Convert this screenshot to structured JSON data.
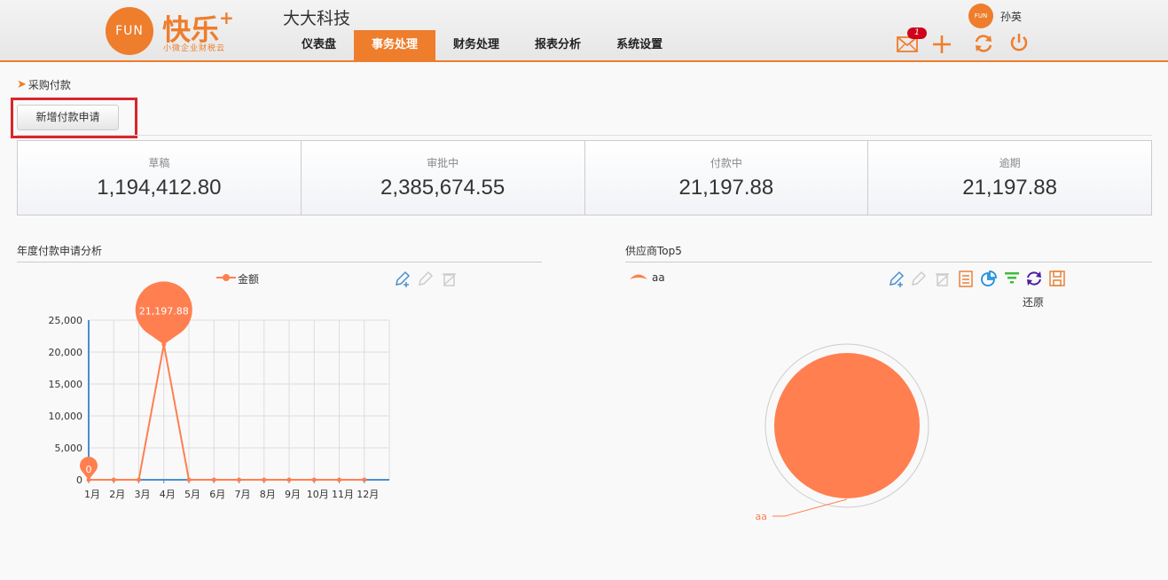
{
  "header": {
    "logo_text": "FUN",
    "brand": "快乐",
    "brand_plus": "+",
    "brand_sub": "小微企业财税云",
    "company": "大大科技",
    "nav": [
      "仪表盘",
      "事务处理",
      "财务处理",
      "报表分析",
      "系统设置"
    ],
    "active_nav": "事务处理",
    "user_avatar_text": "FUN",
    "user_name": "孙英",
    "mail_count": "1",
    "icons": [
      "mail-icon",
      "plus-icon",
      "refresh-icon",
      "power-icon"
    ]
  },
  "breadcrumb": "采购付款",
  "new_button": "新增付款申请",
  "stats": [
    {
      "label": "草稿",
      "value": "1,194,412.80"
    },
    {
      "label": "审批中",
      "value": "2,385,674.55"
    },
    {
      "label": "付款中",
      "value": "21,197.88"
    },
    {
      "label": "逾期",
      "value": "21,197.88"
    }
  ],
  "line_panel": {
    "title": "年度付款申请分析",
    "legend": "金额",
    "tools": [
      "pencil-plus-icon",
      "pencil-icon",
      "trash-icon"
    ]
  },
  "pie_panel": {
    "title": "供应商Top5",
    "legend": "aa",
    "restore_label": "还原",
    "tools": [
      "pencil-plus-icon",
      "pencil-icon",
      "trash-icon",
      "data-view-icon",
      "pie-chart-icon",
      "funnel-icon",
      "restore-icon",
      "save-image-icon"
    ]
  },
  "colors": {
    "accent": "#ee7d2c",
    "series": "#ff7f50",
    "axis": "#4a8fd0",
    "badge": "#d0021b"
  },
  "chart_data": [
    {
      "type": "line",
      "title": "",
      "categories": [
        "1月",
        "2月",
        "3月",
        "4月",
        "5月",
        "6月",
        "7月",
        "8月",
        "9月",
        "10月",
        "11月",
        "12月"
      ],
      "series": [
        {
          "name": "金额",
          "values": [
            0,
            0,
            0,
            21197.88,
            0,
            0,
            0,
            0,
            0,
            0,
            0,
            0
          ]
        }
      ],
      "ylim": [
        0,
        25000
      ],
      "yticks": [
        "0",
        "5,000",
        "10,000",
        "15,000",
        "20,000",
        "25,000"
      ],
      "markpoints": [
        {
          "label": "21,197.88"
        },
        {
          "label": "0"
        }
      ],
      "grid": true,
      "legend": "top"
    },
    {
      "type": "pie",
      "title": "",
      "categories": [
        "aa"
      ],
      "values": [
        21197.88
      ],
      "legend": "top-left"
    }
  ]
}
